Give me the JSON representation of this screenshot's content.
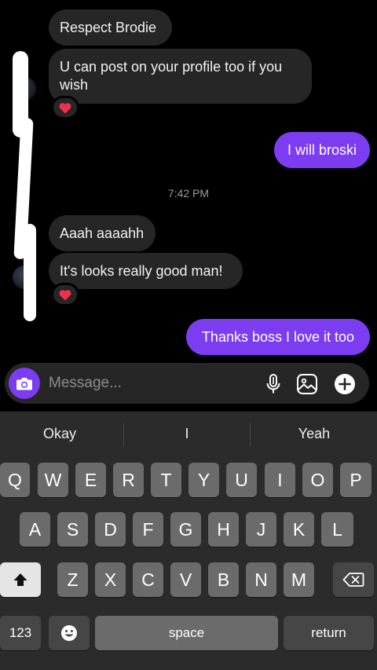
{
  "conversation": {
    "messages": [
      {
        "direction": "incoming",
        "text": "Respect Brodie"
      },
      {
        "direction": "incoming",
        "text": "U can post on your profile too if you wish",
        "reaction": "❤️"
      },
      {
        "direction": "outgoing",
        "text": "I will broski"
      },
      {
        "direction": "incoming",
        "text": "Aaah aaaahh"
      },
      {
        "direction": "incoming",
        "text": "It's looks really good man!",
        "reaction": "❤️"
      },
      {
        "direction": "outgoing",
        "text": "Thanks boss I love it too"
      }
    ],
    "timestamp": "7:42 PM",
    "reaction_heart": "❤️"
  },
  "composer": {
    "placeholder": "Message...",
    "icons": [
      "camera-icon",
      "microphone-icon",
      "gallery-icon",
      "plus-icon"
    ]
  },
  "keyboard": {
    "suggestions": [
      "Okay",
      "I",
      "Yeah"
    ],
    "row1": [
      "Q",
      "W",
      "E",
      "R",
      "T",
      "Y",
      "U",
      "I",
      "O",
      "P"
    ],
    "row2": [
      "A",
      "S",
      "D",
      "F",
      "G",
      "H",
      "J",
      "K",
      "L"
    ],
    "row3": [
      "Z",
      "X",
      "C",
      "V",
      "B",
      "N",
      "M"
    ],
    "numbers_label": "123",
    "space_label": "space",
    "return_label": "return"
  },
  "colors": {
    "accent": "#7c3cf0",
    "incoming_bubble": "#262626",
    "background": "#000000",
    "keyboard": "#2b2b2b"
  }
}
